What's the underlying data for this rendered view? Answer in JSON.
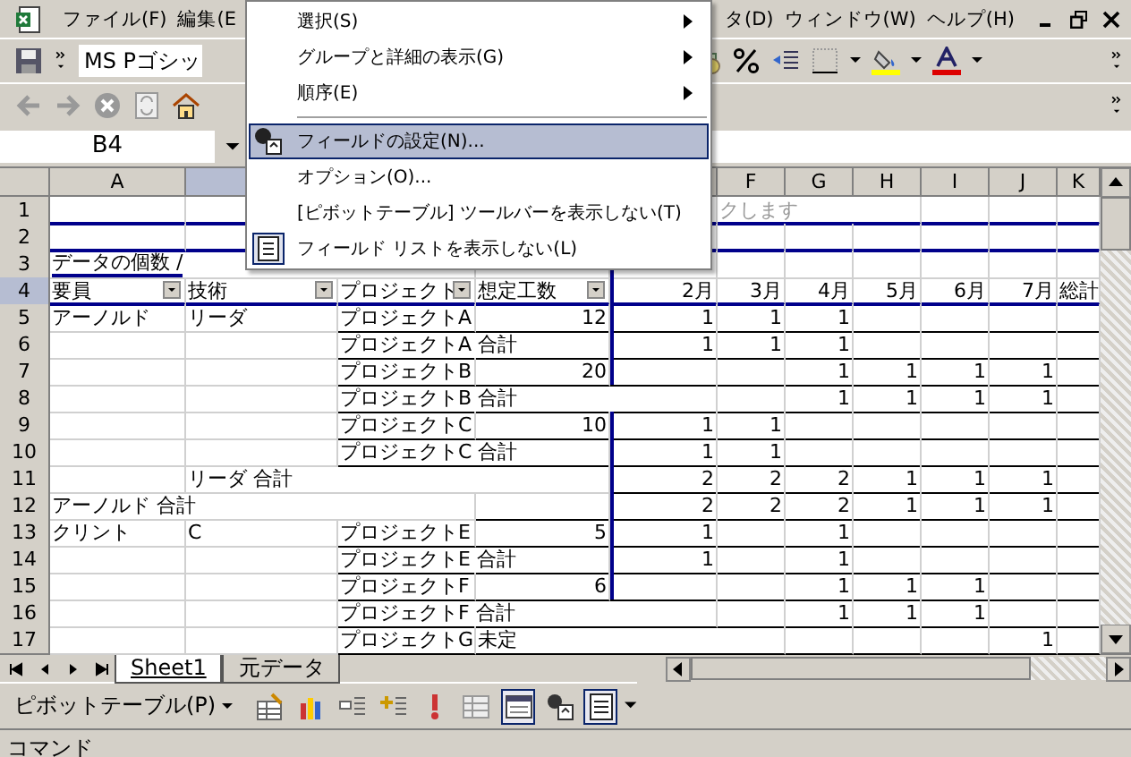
{
  "menu_bar": {
    "items": [
      "ファイル(F)",
      "編集(E",
      "タ(D)",
      "ウィンドウ(W)",
      "ヘルプ(H)"
    ]
  },
  "formatting_toolbar": {
    "font_name": "MS Pゴシッ"
  },
  "name_box": {
    "value": "B4"
  },
  "grid": {
    "columns": [
      {
        "label": "A",
        "selected": false
      },
      {
        "selected": true
      },
      {
        "label": "F",
        "selected": false
      },
      {
        "label": "G",
        "selected": false
      },
      {
        "label": "H",
        "selected": false
      },
      {
        "label": "I",
        "selected": false
      },
      {
        "label": "J",
        "selected": false
      },
      {
        "label": "K",
        "selected": false
      }
    ],
    "rows": [
      {
        "number": "1",
        "selected": false,
        "kind": "note",
        "cells": {
          "F": "クします"
        }
      },
      {
        "number": "2",
        "selected": false,
        "kind": "blank",
        "cells": {}
      },
      {
        "number": "3",
        "selected": false,
        "kind": "title",
        "cells": {
          "A": "データの個数 /"
        }
      },
      {
        "number": "4",
        "selected": true,
        "kind": "header",
        "cells": {
          "A": "要員",
          "B": "技術",
          "C": "プロジェクト",
          "D": "想定工数",
          "E": "2月",
          "F": "3月",
          "G": "4月",
          "H": "5月",
          "I": "6月",
          "J": "7月",
          "K": "総計"
        }
      },
      {
        "number": "5",
        "selected": false,
        "kind": "data",
        "cells": {
          "A": "アーノルド",
          "B": "リーダ",
          "C": "プロジェクトA",
          "D": "12",
          "E": "1",
          "F": "1",
          "G": "1"
        }
      },
      {
        "number": "6",
        "selected": false,
        "kind": "data",
        "cells": {
          "C": "プロジェクトA 合計",
          "E": "1",
          "F": "1",
          "G": "1"
        }
      },
      {
        "number": "7",
        "selected": false,
        "kind": "data",
        "cells": {
          "C": "プロジェクトB",
          "D": "20",
          "G": "1",
          "H": "1",
          "I": "1",
          "J": "1"
        }
      },
      {
        "number": "8",
        "selected": false,
        "kind": "data",
        "cells": {
          "C": "プロジェクトB 合計",
          "G": "1",
          "H": "1",
          "I": "1",
          "J": "1"
        }
      },
      {
        "number": "9",
        "selected": false,
        "kind": "data",
        "cells": {
          "C": "プロジェクトC",
          "D": "10",
          "E": "1",
          "F": "1"
        }
      },
      {
        "number": "10",
        "selected": false,
        "kind": "data",
        "cells": {
          "C": "プロジェクトC 合計",
          "E": "1",
          "F": "1"
        }
      },
      {
        "number": "11",
        "selected": false,
        "kind": "data",
        "cells": {
          "B": "リーダ 合計",
          "E": "2",
          "F": "2",
          "G": "2",
          "H": "1",
          "I": "1",
          "J": "1"
        }
      },
      {
        "number": "12",
        "selected": false,
        "kind": "data",
        "cells": {
          "A": "アーノルド 合計",
          "E": "2",
          "F": "2",
          "G": "2",
          "H": "1",
          "I": "1",
          "J": "1"
        }
      },
      {
        "number": "13",
        "selected": false,
        "kind": "data",
        "cells": {
          "A": "クリント",
          "B": "C",
          "C": "プロジェクトE",
          "D": "5",
          "E": "1",
          "G": "1"
        }
      },
      {
        "number": "14",
        "selected": false,
        "kind": "data",
        "cells": {
          "C": "プロジェクトE 合計",
          "E": "1",
          "G": "1"
        }
      },
      {
        "number": "15",
        "selected": false,
        "kind": "data",
        "cells": {
          "C": "プロジェクトF",
          "D": "6",
          "G": "1",
          "H": "1",
          "I": "1"
        }
      },
      {
        "number": "16",
        "selected": false,
        "kind": "data",
        "cells": {
          "C": "プロジェクトF 合計",
          "G": "1",
          "H": "1",
          "I": "1"
        }
      },
      {
        "number": "17",
        "selected": false,
        "kind": "data",
        "cells": {
          "C": "プロジェクトG",
          "D": "未定",
          "J": "1"
        }
      }
    ]
  },
  "context_menu": {
    "items": [
      {
        "kind": "submenu",
        "label": "選択(S)",
        "selected": false,
        "checked": false
      },
      {
        "kind": "submenu",
        "label": "グループと詳細の表示(G)",
        "selected": false,
        "checked": false
      },
      {
        "kind": "submenu",
        "label": "順序(E)",
        "selected": false,
        "checked": false
      },
      {
        "kind": "separator"
      },
      {
        "kind": "command",
        "label": "フィールドの設定(N)...",
        "selected": true,
        "checked": false
      },
      {
        "kind": "command",
        "label": "オプション(O)...",
        "selected": false,
        "checked": false
      },
      {
        "kind": "command",
        "label": "[ピボットテーブル] ツールバーを表示しない(T)",
        "selected": false,
        "checked": false
      },
      {
        "kind": "command",
        "label": "フィールド リストを表示しない(L)",
        "selected": false,
        "checked": true
      }
    ]
  },
  "sheet_tabs": [
    {
      "label": "Sheet1",
      "selected": true
    },
    {
      "label": "元データ",
      "selected": false
    }
  ],
  "pivot_toolbar": {
    "label": "ピボットテーブル(P)",
    "buttons": [
      {
        "pressed": false
      },
      {
        "pressed": false
      },
      {
        "pressed": false
      },
      {
        "pressed": false
      },
      {
        "pressed": false
      },
      {
        "pressed": false
      },
      {
        "pressed": true
      },
      {
        "pressed": false
      },
      {
        "pressed": true
      }
    ]
  },
  "status_bar": {
    "text": "コマンド"
  }
}
